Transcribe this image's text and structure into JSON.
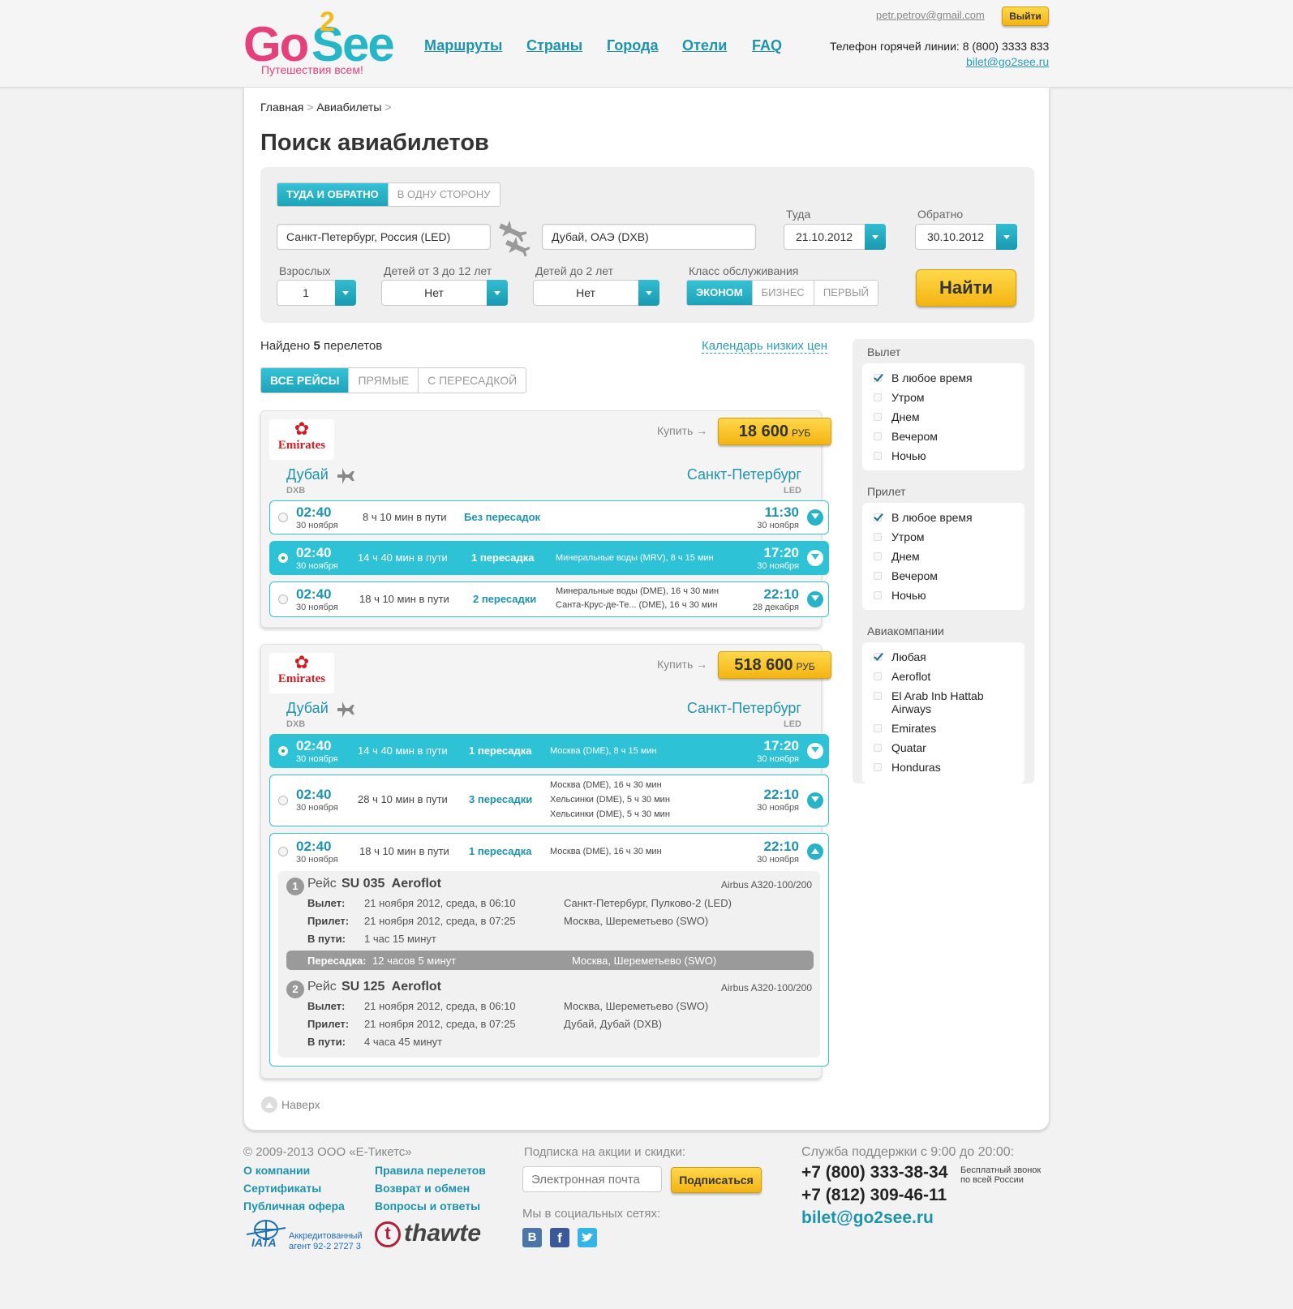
{
  "header": {
    "logo_go": "Go",
    "logo_two": "2",
    "logo_see": "See",
    "logo_tagline": "Путешествия всем!",
    "nav": [
      "Маршруты",
      "Страны",
      "Города",
      "Отели",
      "FAQ"
    ],
    "user_email": "petr.petrov@gmail.com",
    "logout": "Выйти",
    "hotline": "Телефон горячей линии: 8 (800) 3333 833",
    "contact_email": "bilet@go2see.ru"
  },
  "breadcrumb": {
    "home": "Главная",
    "sep1": ">",
    "current": "Авиабилеты",
    "sep2": ">"
  },
  "page_title": "Поиск авиабилетов",
  "search": {
    "trip_types": [
      "ТУДА И ОБРАТНО",
      "В ОДНУ СТОРОНУ"
    ],
    "from": "Санкт-Петербург, Россия (LED)",
    "to": "Дубай, ОАЭ (DXB)",
    "depart_label": "Туда",
    "depart_date": "21.10.2012",
    "return_label": "Обратно",
    "return_date": "30.10.2012",
    "adults_label": "Взрослых",
    "adults": "1",
    "children_label": "Детей от 3 до 12 лет",
    "children": "Нет",
    "infants_label": "Детей до 2 лет",
    "infants": "Нет",
    "class_label": "Класс обслуживания",
    "classes": [
      "ЭКОНОМ",
      "БИЗНЕС",
      "ПЕРВЫЙ"
    ],
    "search_button": "Найти"
  },
  "results": {
    "found_prefix": "Найдено",
    "found_count": "5",
    "found_suffix": "перелетов",
    "calendar_link": "Календарь низких цен",
    "filters": [
      "ВСЕ РЕЙСЫ",
      "ПРЯМЫЕ",
      "С ПЕРЕСАДКОЙ"
    ],
    "buy_label": "Купить →",
    "currency": "РУБ"
  },
  "cards": [
    {
      "airline": "Emirates",
      "price": "18 600",
      "from_city": "Дубай",
      "from_code": "DXB",
      "to_city": "Санкт-Петербург",
      "to_code": "LED",
      "rows": [
        {
          "dep": "02:40",
          "dep_date": "30 ноября",
          "duration": "8 ч 10 мин в пути",
          "stops": "Без пересадок",
          "via1": "",
          "via2": "",
          "via3": "",
          "arr": "11:30",
          "arr_date": "30 ноября"
        },
        {
          "dep": "02:40",
          "dep_date": "30 ноября",
          "duration": "14 ч 40 мин в пути",
          "stops": "1 пересадка",
          "via1": "Минеральные воды (MRV), 8 ч 15 мин",
          "via2": "",
          "via3": "",
          "arr": "17:20",
          "arr_date": "30 ноября"
        },
        {
          "dep": "02:40",
          "dep_date": "30 ноября",
          "duration": "18 ч 10 мин в пути",
          "stops": "2 пересадки",
          "via1": "Минеральные воды (DME), 16 ч 30 мин",
          "via2": "Санта-Крус-де-Те... (DME), 16 ч 30 мин",
          "via3": "",
          "arr": "22:10",
          "arr_date": "28 декабря"
        }
      ]
    },
    {
      "airline": "Emirates",
      "price": "518 600",
      "from_city": "Дубай",
      "from_code": "DXB",
      "to_city": "Санкт-Петербург",
      "to_code": "LED",
      "rows": [
        {
          "dep": "02:40",
          "dep_date": "30 ноября",
          "duration": "14 ч 40 мин в пути",
          "stops": "1 пересадка",
          "via1": "Москва (DME), 8 ч 15 мин",
          "via2": "",
          "via3": "",
          "arr": "17:20",
          "arr_date": "30 ноября"
        },
        {
          "dep": "02:40",
          "dep_date": "30 ноября",
          "duration": "28 ч 10 мин в пути",
          "stops": "3 пересадки",
          "via1": "Москва (DME), 16 ч 30 мин",
          "via2": "Хельсинки (DME), 5 ч 30 мин",
          "via3": "Хельсинки (DME), 5 ч 30 мин",
          "arr": "22:10",
          "arr_date": "30 ноября"
        },
        {
          "dep": "02:40",
          "dep_date": "30 ноября",
          "duration": "18 ч 10 мин в пути",
          "stops": "1 пересадка",
          "via1": "Москва (DME), 16 ч 30 мин",
          "via2": "",
          "via3": "",
          "arr": "22:10",
          "arr_date": "30 ноября"
        }
      ]
    }
  ],
  "details": {
    "flight_word": "Рейс",
    "dep_label": "Вылет:",
    "arr_label": "Прилет:",
    "dur_label": "В пути:",
    "transfer_label": "Пересадка:",
    "transfer_time": "12 часов 5 минут",
    "transfer_place": "Москва, Шереметьево (SWO)",
    "segments": [
      {
        "num": "1",
        "flight": "SU 035  Aeroflot",
        "aircraft": "Airbus A320-100/200",
        "dep_time": "21 ноября 2012, среда, в 06:10",
        "dep_place": "Санкт-Петербург, Пулково-2 (LED)",
        "arr_time": "21 ноября 2012, среда, в 07:25",
        "arr_place": "Москва, Шереметьево (SWO)",
        "duration": "1 час 15 минут"
      },
      {
        "num": "2",
        "flight": "SU 125  Aeroflot",
        "aircraft": "Airbus A320-100/200",
        "dep_time": "21 ноября 2012, среда, в 06:10",
        "dep_place": "Москва, Шереметьево (SWO)",
        "arr_time": "21 ноября 2012, среда, в 07:25",
        "arr_place": "Дубай, Дубай (DXB)",
        "duration": "4 часа 45 минут"
      }
    ]
  },
  "to_top": "Наверх",
  "sidebar": {
    "groups": [
      {
        "title": "Вылет",
        "items": [
          "В любое время",
          "Утром",
          "Днем",
          "Вечером",
          "Ночью"
        ]
      },
      {
        "title": "Прилет",
        "items": [
          "В любое время",
          "Утром",
          "Днем",
          "Вечером",
          "Ночью"
        ]
      },
      {
        "title": "Авиакомпании",
        "items": [
          "Любая",
          "Aeroflot",
          "El Arab Inb Hattab Airways",
          "Emirates",
          "Quatar",
          "Honduras"
        ]
      }
    ]
  },
  "footer": {
    "copyright": "© 2009-2013 ООО «Е-Тикетс»",
    "links_left": [
      "О компании",
      "Сертификаты",
      "Публичная офера"
    ],
    "links_right": [
      "Правила перелетов",
      "Возврат и обмен",
      "Вопросы и ответы"
    ],
    "iata_text": "Аккредитованный агент 92-2 2727 3",
    "iata_logo": "IATA",
    "thawte": "thawte",
    "subscribe_title": "Подписка на акции и скидки:",
    "email_placeholder": "Электронная почта",
    "subscribe_button": "Подписаться",
    "social_title": "Мы в социальных сетях:",
    "support_title": "Служба поддержки с 9:00 до 20:00:",
    "phone1": "+7 (800) 333-38-34",
    "free_call": "Бесплатный звонок по всей России",
    "phone2": "+7 (812) 309-46-11",
    "support_email": "bilet@go2see.ru"
  },
  "colors": {
    "accent": "#2ec2d6",
    "link": "#1e93ae",
    "button_yellow": "#f6c222",
    "logo_pink": "#e6407a"
  }
}
